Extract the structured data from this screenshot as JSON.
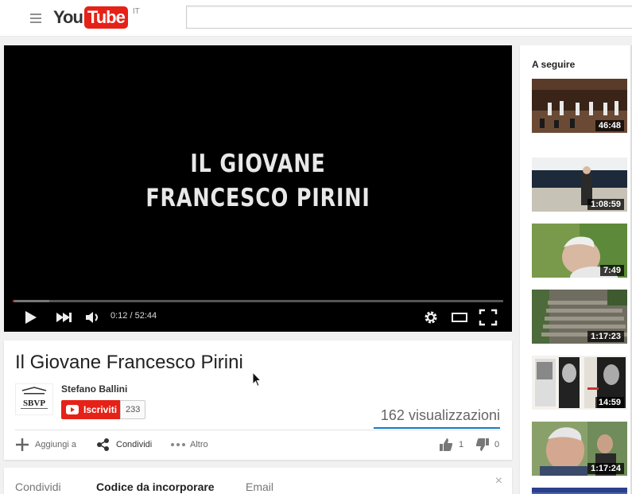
{
  "masthead": {
    "logo_you": "You",
    "logo_tube": "Tube",
    "country": "IT",
    "search_placeholder": ""
  },
  "player": {
    "title_line1": "IL GIOVANE",
    "title_line2": "FRANCESCO PIRINI",
    "time": "0:12 / 52:44",
    "progress_fraction": 0.004,
    "buffer_fraction": 0.075
  },
  "watch": {
    "title": "Il Giovane Francesco Pirini",
    "owner": "Stefano Ballini",
    "avatar_text": "SBVP",
    "subscribe_label": "Iscriviti",
    "subscriber_count": "233",
    "views": "162 visualizzazioni",
    "actions": {
      "add_to": "Aggiungi a",
      "share": "Condividi",
      "more": "Altro"
    },
    "likes": "1",
    "dislikes": "0"
  },
  "share_panel": {
    "tabs": [
      "Condividi",
      "Codice da incorporare",
      "Email"
    ],
    "active_tab": 1,
    "close": "×"
  },
  "sidebar": {
    "heading": "A seguire",
    "items": [
      {
        "duration": "46:48"
      },
      {
        "duration": "1:08:59"
      },
      {
        "duration": "7:49"
      },
      {
        "duration": "1:17:23"
      },
      {
        "duration": "14:59"
      },
      {
        "duration": "1:17:24"
      }
    ]
  },
  "colors": {
    "brand_red": "#e62117",
    "accent_blue": "#167ac6"
  }
}
